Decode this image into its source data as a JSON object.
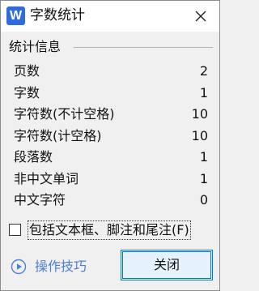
{
  "window": {
    "title": "字数统计",
    "app_icon_letter": "W"
  },
  "group": {
    "title": "统计信息",
    "rows": [
      {
        "label": "页数",
        "value": "2"
      },
      {
        "label": "字数",
        "value": "1"
      },
      {
        "label": "字符数(不计空格)",
        "value": "10"
      },
      {
        "label": "字符数(计空格)",
        "value": "10"
      },
      {
        "label": "段落数",
        "value": "1"
      },
      {
        "label": "非中文单词",
        "value": "1"
      },
      {
        "label": "中文字符",
        "value": "0"
      }
    ]
  },
  "options": {
    "include_textboxes_label": "包括文本框、脚注和尾注(F)",
    "include_textboxes_checked": false
  },
  "footer": {
    "tips_label": "操作技巧",
    "close_label": "关闭"
  },
  "colors": {
    "accent": "#0078d7",
    "link": "#4b7fd6",
    "app_icon": "#2f6cd9"
  }
}
